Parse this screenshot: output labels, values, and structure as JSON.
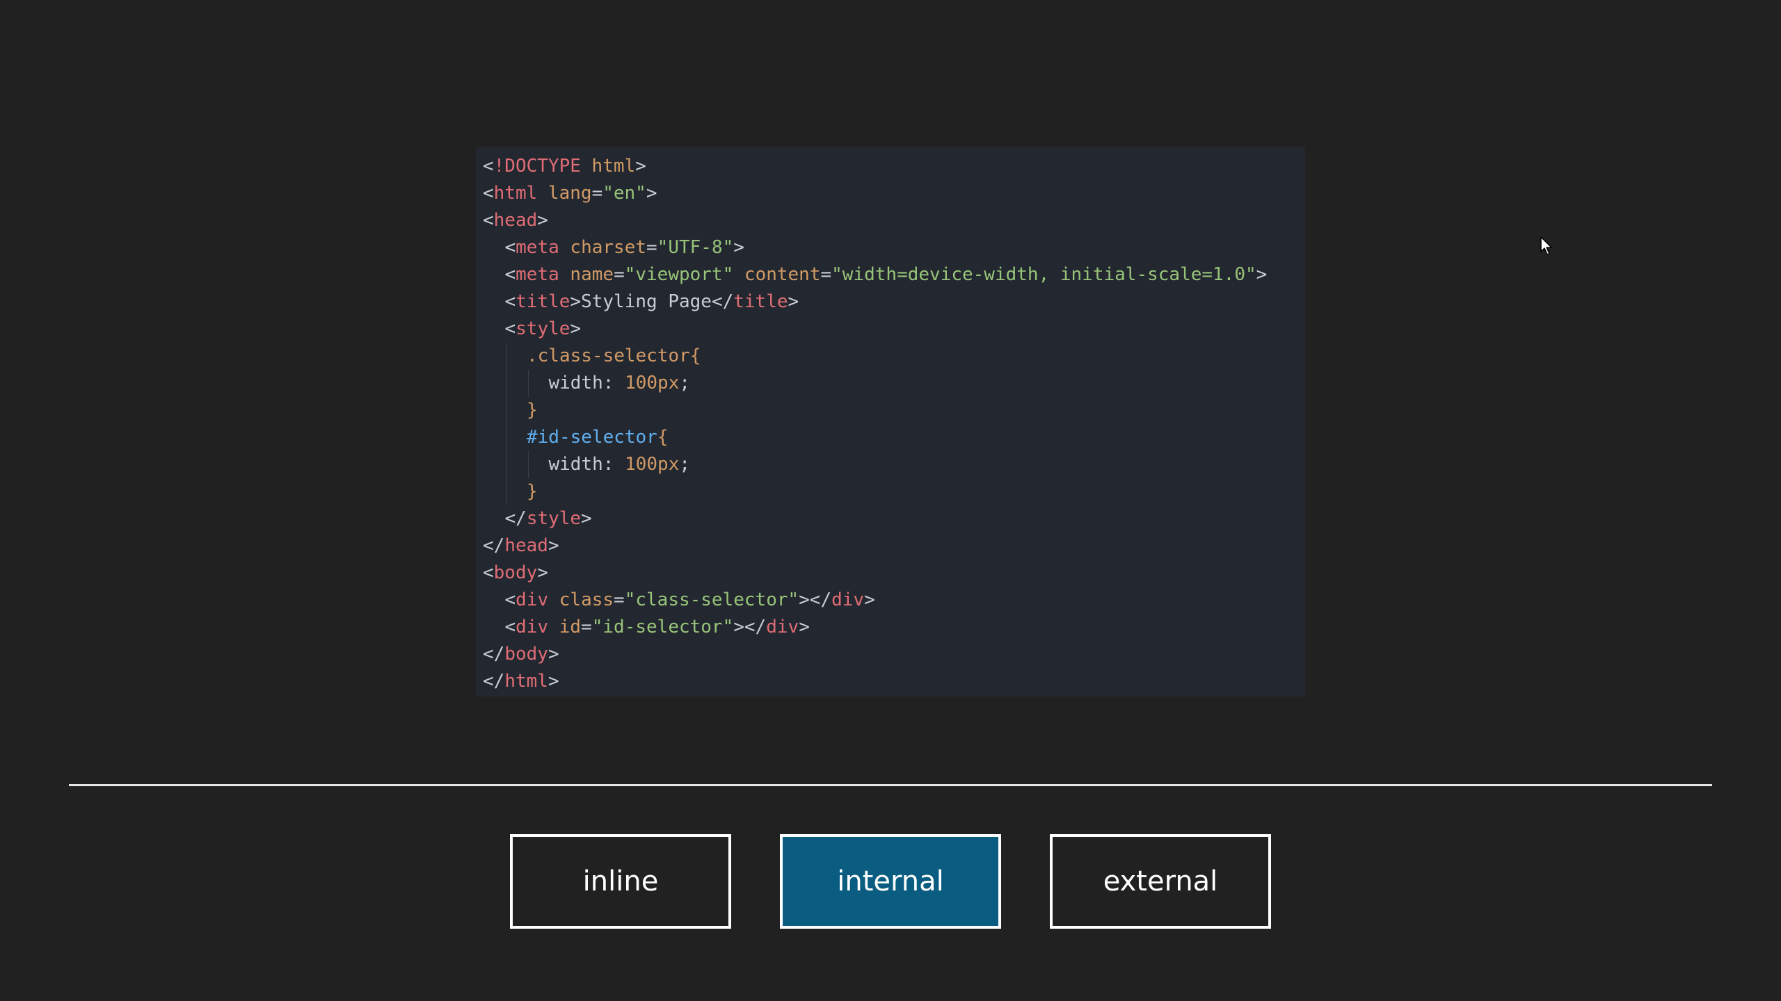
{
  "code": {
    "lines": [
      {
        "indent": 0,
        "tokens": [
          {
            "k": "punc",
            "t": "<"
          },
          {
            "k": "tag",
            "t": "!DOCTYPE"
          },
          {
            "k": "attr",
            "t": " html"
          },
          {
            "k": "punc",
            "t": ">"
          }
        ]
      },
      {
        "indent": 0,
        "tokens": [
          {
            "k": "punc",
            "t": "<"
          },
          {
            "k": "tag",
            "t": "html"
          },
          {
            "k": "attr",
            "t": " lang"
          },
          {
            "k": "punc",
            "t": "="
          },
          {
            "k": "str",
            "t": "\"en\""
          },
          {
            "k": "punc",
            "t": ">"
          }
        ]
      },
      {
        "indent": 0,
        "tokens": [
          {
            "k": "punc",
            "t": "<"
          },
          {
            "k": "tag",
            "t": "head"
          },
          {
            "k": "punc",
            "t": ">"
          }
        ]
      },
      {
        "indent": 1,
        "tokens": [
          {
            "k": "punc",
            "t": "<"
          },
          {
            "k": "tag",
            "t": "meta"
          },
          {
            "k": "attr",
            "t": " charset"
          },
          {
            "k": "punc",
            "t": "="
          },
          {
            "k": "str",
            "t": "\"UTF-8\""
          },
          {
            "k": "punc",
            "t": ">"
          }
        ]
      },
      {
        "indent": 1,
        "tokens": [
          {
            "k": "punc",
            "t": "<"
          },
          {
            "k": "tag",
            "t": "meta"
          },
          {
            "k": "attr",
            "t": " name"
          },
          {
            "k": "punc",
            "t": "="
          },
          {
            "k": "str",
            "t": "\"viewport\""
          },
          {
            "k": "attr",
            "t": " content"
          },
          {
            "k": "punc",
            "t": "="
          },
          {
            "k": "str",
            "t": "\"width=device-width, initial-scale=1.0\""
          },
          {
            "k": "punc",
            "t": ">"
          }
        ]
      },
      {
        "indent": 1,
        "tokens": [
          {
            "k": "punc",
            "t": "<"
          },
          {
            "k": "tag",
            "t": "title"
          },
          {
            "k": "punc",
            "t": ">"
          },
          {
            "k": "text",
            "t": "Styling Page"
          },
          {
            "k": "punc",
            "t": "</"
          },
          {
            "k": "tag",
            "t": "title"
          },
          {
            "k": "punc",
            "t": ">"
          }
        ]
      },
      {
        "indent": 1,
        "tokens": [
          {
            "k": "punc",
            "t": "<"
          },
          {
            "k": "tag",
            "t": "style"
          },
          {
            "k": "punc",
            "t": ">"
          }
        ]
      },
      {
        "indent": 2,
        "tokens": [
          {
            "k": "sel",
            "t": ".class-selector"
          },
          {
            "k": "brace",
            "t": "{"
          }
        ]
      },
      {
        "indent": 3,
        "tokens": [
          {
            "k": "prop",
            "t": "width"
          },
          {
            "k": "punc",
            "t": ": "
          },
          {
            "k": "num",
            "t": "100px"
          },
          {
            "k": "punc",
            "t": ";"
          }
        ]
      },
      {
        "indent": 2,
        "tokens": [
          {
            "k": "brace",
            "t": "}"
          }
        ]
      },
      {
        "indent": 2,
        "tokens": [
          {
            "k": "id",
            "t": "#id-selector"
          },
          {
            "k": "brace",
            "t": "{"
          }
        ]
      },
      {
        "indent": 3,
        "tokens": [
          {
            "k": "prop",
            "t": "width"
          },
          {
            "k": "punc",
            "t": ": "
          },
          {
            "k": "num",
            "t": "100px"
          },
          {
            "k": "punc",
            "t": ";"
          }
        ]
      },
      {
        "indent": 2,
        "tokens": [
          {
            "k": "brace",
            "t": "}"
          }
        ]
      },
      {
        "indent": 1,
        "tokens": [
          {
            "k": "punc",
            "t": "</"
          },
          {
            "k": "tag",
            "t": "style"
          },
          {
            "k": "punc",
            "t": ">"
          }
        ]
      },
      {
        "indent": 0,
        "tokens": [
          {
            "k": "punc",
            "t": "</"
          },
          {
            "k": "tag",
            "t": "head"
          },
          {
            "k": "punc",
            "t": ">"
          }
        ]
      },
      {
        "indent": 0,
        "tokens": [
          {
            "k": "punc",
            "t": "<"
          },
          {
            "k": "tag",
            "t": "body"
          },
          {
            "k": "punc",
            "t": ">"
          }
        ]
      },
      {
        "indent": 1,
        "tokens": [
          {
            "k": "punc",
            "t": "<"
          },
          {
            "k": "tag",
            "t": "div"
          },
          {
            "k": "attr",
            "t": " class"
          },
          {
            "k": "punc",
            "t": "="
          },
          {
            "k": "str",
            "t": "\"class-selector\""
          },
          {
            "k": "punc",
            "t": "></"
          },
          {
            "k": "tag",
            "t": "div"
          },
          {
            "k": "punc",
            "t": ">"
          }
        ]
      },
      {
        "indent": 1,
        "tokens": [
          {
            "k": "punc",
            "t": "<"
          },
          {
            "k": "tag",
            "t": "div"
          },
          {
            "k": "attr",
            "t": " id"
          },
          {
            "k": "punc",
            "t": "="
          },
          {
            "k": "str",
            "t": "\"id-selector\""
          },
          {
            "k": "punc",
            "t": "></"
          },
          {
            "k": "tag",
            "t": "div"
          },
          {
            "k": "punc",
            "t": ">"
          }
        ]
      },
      {
        "indent": 0,
        "tokens": [
          {
            "k": "punc",
            "t": "</"
          },
          {
            "k": "tag",
            "t": "body"
          },
          {
            "k": "punc",
            "t": ">"
          }
        ]
      },
      {
        "indent": 0,
        "tokens": [
          {
            "k": "punc",
            "t": "</"
          },
          {
            "k": "tag",
            "t": "html"
          },
          {
            "k": "punc",
            "t": ">"
          }
        ]
      }
    ]
  },
  "tabs": {
    "inline": "inline",
    "internal": "internal",
    "external": "external",
    "active": "internal"
  },
  "colors": {
    "background": "#212121",
    "code_background": "#232830",
    "active_tab": "#0a5c80",
    "tag": "#e06c75",
    "attribute": "#d19a66",
    "string": "#98c379",
    "id_selector": "#61afef"
  },
  "icons": {
    "cursor": "mouse-pointer-icon"
  }
}
